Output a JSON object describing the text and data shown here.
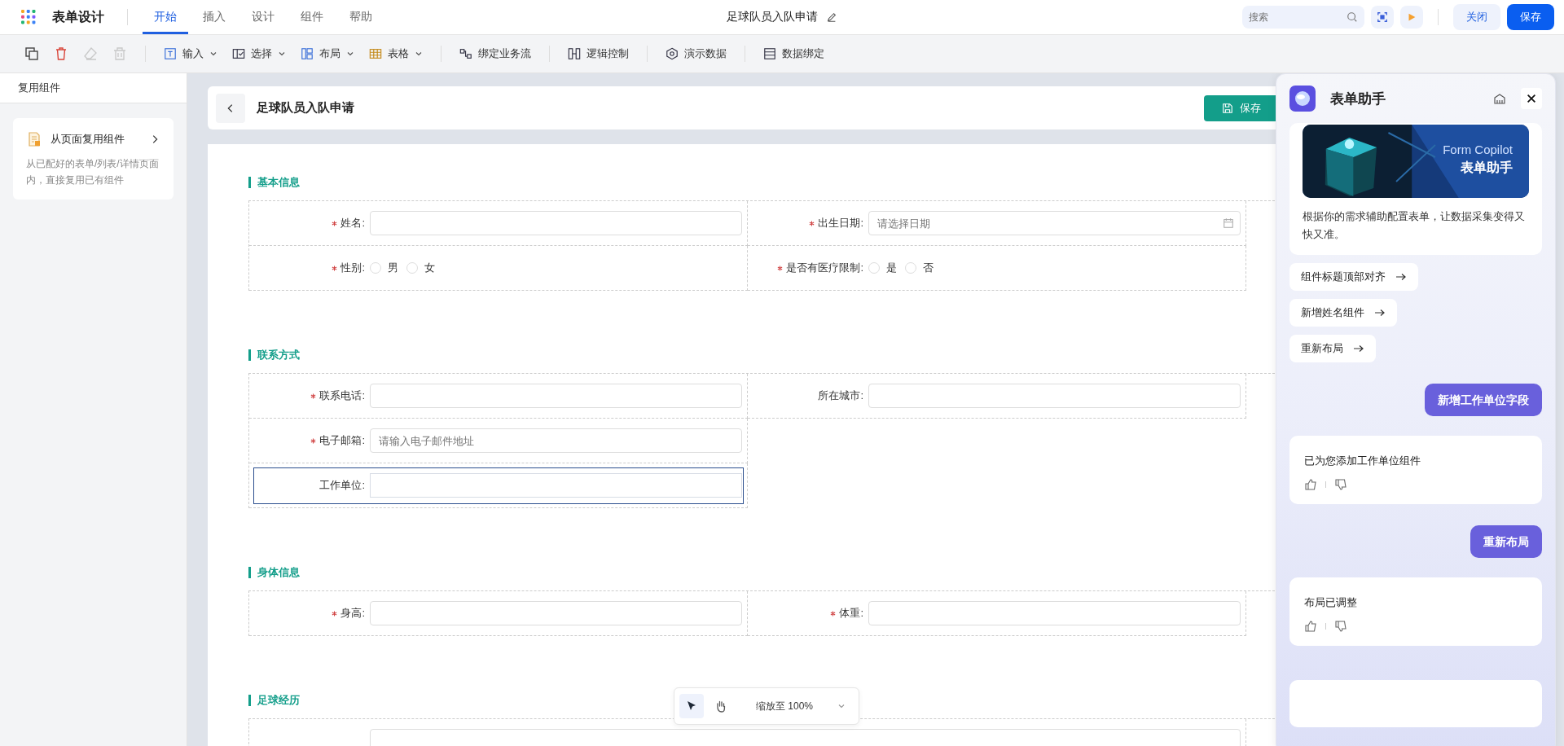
{
  "app": {
    "title": "表单设计",
    "doc_title": "足球队员入队申请",
    "search_placeholder": "搜索",
    "close_label": "关闭",
    "save_label": "保存"
  },
  "menu_tabs": [
    {
      "label": "开始",
      "selected": true
    },
    {
      "label": "插入",
      "selected": false
    },
    {
      "label": "设计",
      "selected": false
    },
    {
      "label": "组件",
      "selected": false
    },
    {
      "label": "帮助",
      "selected": false
    }
  ],
  "toolbar": {
    "icon_buttons": [
      {
        "disabled": false
      },
      {
        "disabled": false
      },
      {
        "disabled": true
      },
      {
        "disabled": true
      }
    ],
    "items": [
      {
        "label": "输入",
        "dropdown": true
      },
      {
        "label": "选择",
        "dropdown": true
      },
      {
        "label": "布局",
        "dropdown": true
      },
      {
        "label": "表格",
        "dropdown": true
      },
      {
        "label": "绑定业务流",
        "dropdown": false
      },
      {
        "label": "逻辑控制",
        "dropdown": false
      },
      {
        "label": "演示数据",
        "dropdown": false
      },
      {
        "label": "数据绑定",
        "dropdown": false
      }
    ]
  },
  "sidebar": {
    "title": "复用组件",
    "card": {
      "title": "从页面复用组件",
      "description": "从已配好的表单/列表/详情页面内，直接复用已有组件"
    }
  },
  "form": {
    "title": "足球队员入队申请",
    "save_label": "保存",
    "sections": [
      {
        "title": "基本信息",
        "fields": [
          {
            "kind": "text",
            "label": "姓名:",
            "required": true,
            "focused": false
          },
          {
            "kind": "date",
            "label": "出生日期:",
            "required": true,
            "placeholder": "请选择日期"
          },
          {
            "kind": "radio",
            "label": "性别:",
            "required": true,
            "options": [
              {
                "label": "男",
                "selected": false
              },
              {
                "label": "女",
                "selected": false
              }
            ]
          },
          {
            "kind": "radio",
            "label": "是否有医疗限制:",
            "required": true,
            "options": [
              {
                "label": "是",
                "selected": false
              },
              {
                "label": "否",
                "selected": false
              }
            ]
          }
        ]
      },
      {
        "title": "联系方式",
        "fields": [
          {
            "kind": "text",
            "label": "联系电话:",
            "required": true,
            "focused": false
          },
          {
            "kind": "text",
            "label": "所在城市:",
            "required": false,
            "focused": false
          },
          {
            "kind": "text",
            "label": "电子邮箱:",
            "required": true,
            "placeholder": "请输入电子邮件地址",
            "focused": false
          },
          {
            "kind": "gap"
          },
          {
            "kind": "text",
            "label": "工作单位:",
            "required": false,
            "focused": true
          }
        ]
      },
      {
        "title": "身体信息",
        "fields": [
          {
            "kind": "text",
            "label": "身高:",
            "required": true,
            "focused": false
          },
          {
            "kind": "text",
            "label": "体重:",
            "required": true,
            "focused": false
          }
        ]
      },
      {
        "title": "足球经历",
        "fields": [
          {
            "kind": "text",
            "wide": true,
            "focused": false
          }
        ]
      }
    ]
  },
  "zoom_bar": {
    "label": "缩放至 100%",
    "tools": [
      {
        "selected": true
      },
      {
        "selected": false
      }
    ]
  },
  "assistant": {
    "title": "表单助手",
    "banner": {
      "line_1": "Form Copilot",
      "line_2": "表单助手"
    },
    "intro": "根据你的需求辅助配置表单，让数据采集变得又快又准。",
    "suggestions": [
      "组件标题顶部对齐",
      "新增姓名组件",
      "重新布局"
    ],
    "messages": [
      {
        "kind": "user",
        "text": "新增工作单位字段"
      },
      {
        "kind": "bot",
        "text": "已为您添加工作单位组件"
      },
      {
        "kind": "user",
        "text": "重新布局"
      },
      {
        "kind": "bot",
        "text": "布局已调整"
      },
      {
        "kind": "composer"
      }
    ]
  }
}
